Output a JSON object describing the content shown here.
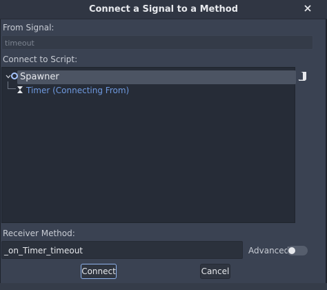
{
  "dialog": {
    "title": "Connect a Signal to a Method",
    "close_icon": "close-icon"
  },
  "from_signal": {
    "label": "From Signal:",
    "value": "timeout"
  },
  "connect_to_script": {
    "label": "Connect to Script:",
    "tree": [
      {
        "label": "Spawner",
        "icon": "node-circle-icon",
        "selected": true,
        "expanded": true
      },
      {
        "label": "Timer (Connecting From)",
        "icon": "timer-hourglass-icon",
        "selected": false
      }
    ],
    "script_icon": "script-icon"
  },
  "receiver_method": {
    "label": "Receiver Method:",
    "value": "_on_Timer_timeout"
  },
  "advanced": {
    "label": "Advanced",
    "enabled": false
  },
  "buttons": {
    "connect": "Connect",
    "cancel": "Cancel"
  },
  "colors": {
    "background": "#3a4252",
    "panel": "#262c37",
    "selection": "#4c5463",
    "accent": "#8fb3ec",
    "link": "#6f9ae0"
  }
}
